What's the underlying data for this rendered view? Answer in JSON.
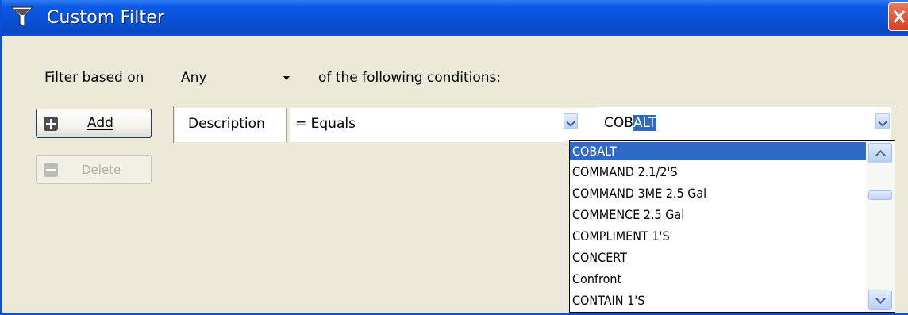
{
  "window": {
    "title": "Custom Filter"
  },
  "filter": {
    "prefix_label": "Filter based on",
    "match_mode": "Any",
    "suffix_label": "of the following conditions:"
  },
  "buttons": {
    "add_label": "Add",
    "delete_label": "Delete"
  },
  "condition": {
    "field": "Description",
    "operator": "= Equals",
    "value_typed": "COB",
    "value_autocomplete": "ALT"
  },
  "dropdown": {
    "selected_index": 0,
    "items": [
      "COBALT",
      "COMMAND  2.1/2'S",
      "COMMAND 3ME  2.5 Gal",
      "COMMENCE  2.5 Gal",
      "COMPLIMENT  1'S",
      "CONCERT",
      "Confront",
      "CONTAIN 1'S"
    ]
  },
  "colors": {
    "titlebar": "#0a51d8",
    "selection": "#316ac5",
    "dialog_bg": "#ece9d8"
  }
}
